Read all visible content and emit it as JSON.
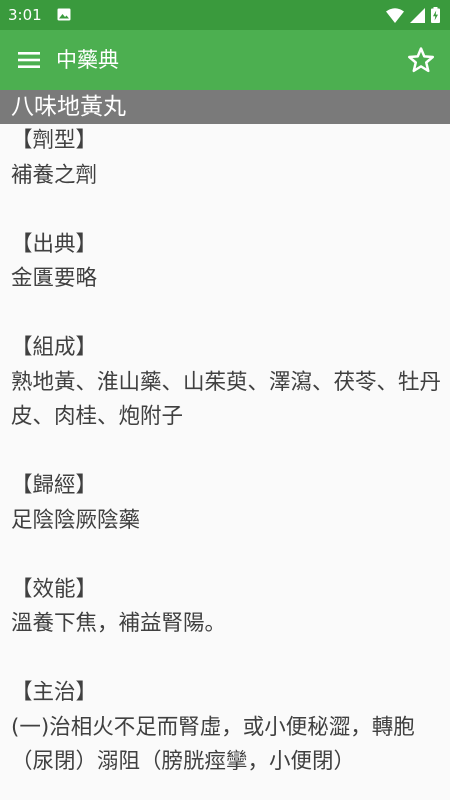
{
  "status_bar": {
    "time": "3:01"
  },
  "app_bar": {
    "title": "中藥典"
  },
  "entry": {
    "title": "八味地黃丸",
    "sections": [
      {
        "heading": "【劑型】",
        "body": "補養之劑"
      },
      {
        "heading": "【出典】",
        "body": "金匱要略"
      },
      {
        "heading": "【組成】",
        "body": "熟地黃、淮山藥、山茱萸、澤瀉、茯苓、牡丹皮、肉桂、炮附子"
      },
      {
        "heading": "【歸經】",
        "body": "足陰陰厥陰藥"
      },
      {
        "heading": "【效能】",
        "body": "溫養下焦，補益腎陽。"
      },
      {
        "heading": "【主治】",
        "body": "(一)治相火不足而腎虛，或小便秘澀，轉胞（尿閉）溺阻（膀胱痙攣，小便閉）"
      }
    ]
  },
  "colors": {
    "status_bar_bg": "#3a9a3d",
    "app_bar_bg": "#4caf50",
    "title_band_bg": "#7a7a7a",
    "content_bg": "#fafafa",
    "body_text": "#404040"
  }
}
